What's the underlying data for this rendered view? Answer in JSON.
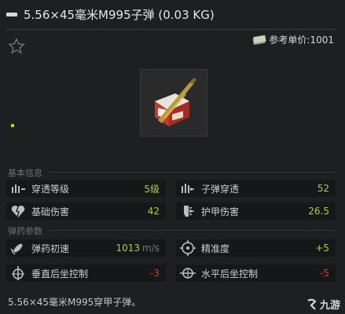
{
  "header": {
    "title": "5.56×45毫米M995子弹 (0.03 KG)"
  },
  "price": {
    "text": "参考单价:1001",
    "icon": "cash-icon"
  },
  "favorite": {
    "icon": "star-icon"
  },
  "sections": {
    "basic": "基本信息",
    "ammo": "弹药参数"
  },
  "stats": [
    {
      "label": "穿透等级",
      "value": "5级",
      "icon": "penetration-icon"
    },
    {
      "label": "子弹穿透",
      "value": "52",
      "icon": "bullet-pierce-icon"
    },
    {
      "label": "基础伤害",
      "value": "42",
      "icon": "heart-damage-icon"
    },
    {
      "label": "护甲伤害",
      "value": "26.5",
      "icon": "armor-damage-icon"
    },
    {
      "label": "弹药初速",
      "value": "1013",
      "unit": "m/s",
      "icon": "velocity-icon"
    },
    {
      "label": "精准度",
      "value": "+5",
      "icon": "crosshair-icon"
    },
    {
      "label": "垂直后坐控制",
      "value": "-3",
      "icon": "vertical-recoil-icon"
    },
    {
      "label": "水平后坐控制",
      "value": "-5",
      "icon": "horizontal-recoil-icon"
    }
  ],
  "description": "5.56×45毫米M995穿甲子弹。",
  "watermark": {
    "text": "九游"
  },
  "colors": {
    "positive": "#b8c93c",
    "negative": "#c8412d",
    "background": "#1e1f21"
  }
}
